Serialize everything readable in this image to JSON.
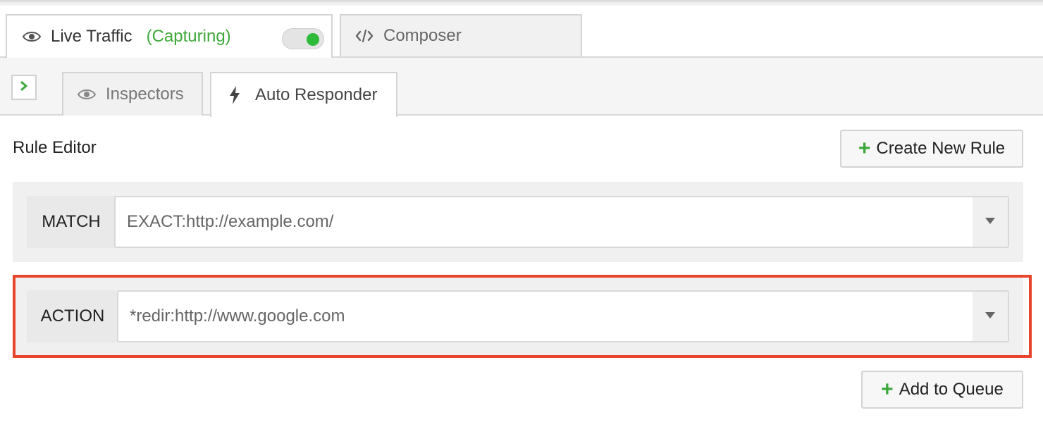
{
  "tabs_top": {
    "live_traffic": {
      "label": "Live Traffic",
      "status": "(Capturing)",
      "icon": "eye-icon",
      "capturing": true
    },
    "composer": {
      "label": "Composer",
      "icon": "code-icon"
    }
  },
  "tabs_secondary": {
    "inspectors": {
      "label": "Inspectors",
      "icon": "eye-icon"
    },
    "auto_responder": {
      "label": "Auto Responder",
      "icon": "lightning-icon"
    }
  },
  "rule_editor": {
    "title": "Rule Editor",
    "create_button": "Create New Rule",
    "match_label": "MATCH",
    "match_value": "EXACT:http://example.com/",
    "action_label": "ACTION",
    "action_value": "*redir:http://www.google.com",
    "queue_button": "Add to Queue"
  },
  "colors": {
    "capturing_green": "#3ea83a",
    "toggle_on": "#2fbb3a",
    "highlight_red": "#e8452c",
    "plus_green": "#3aa83a"
  }
}
